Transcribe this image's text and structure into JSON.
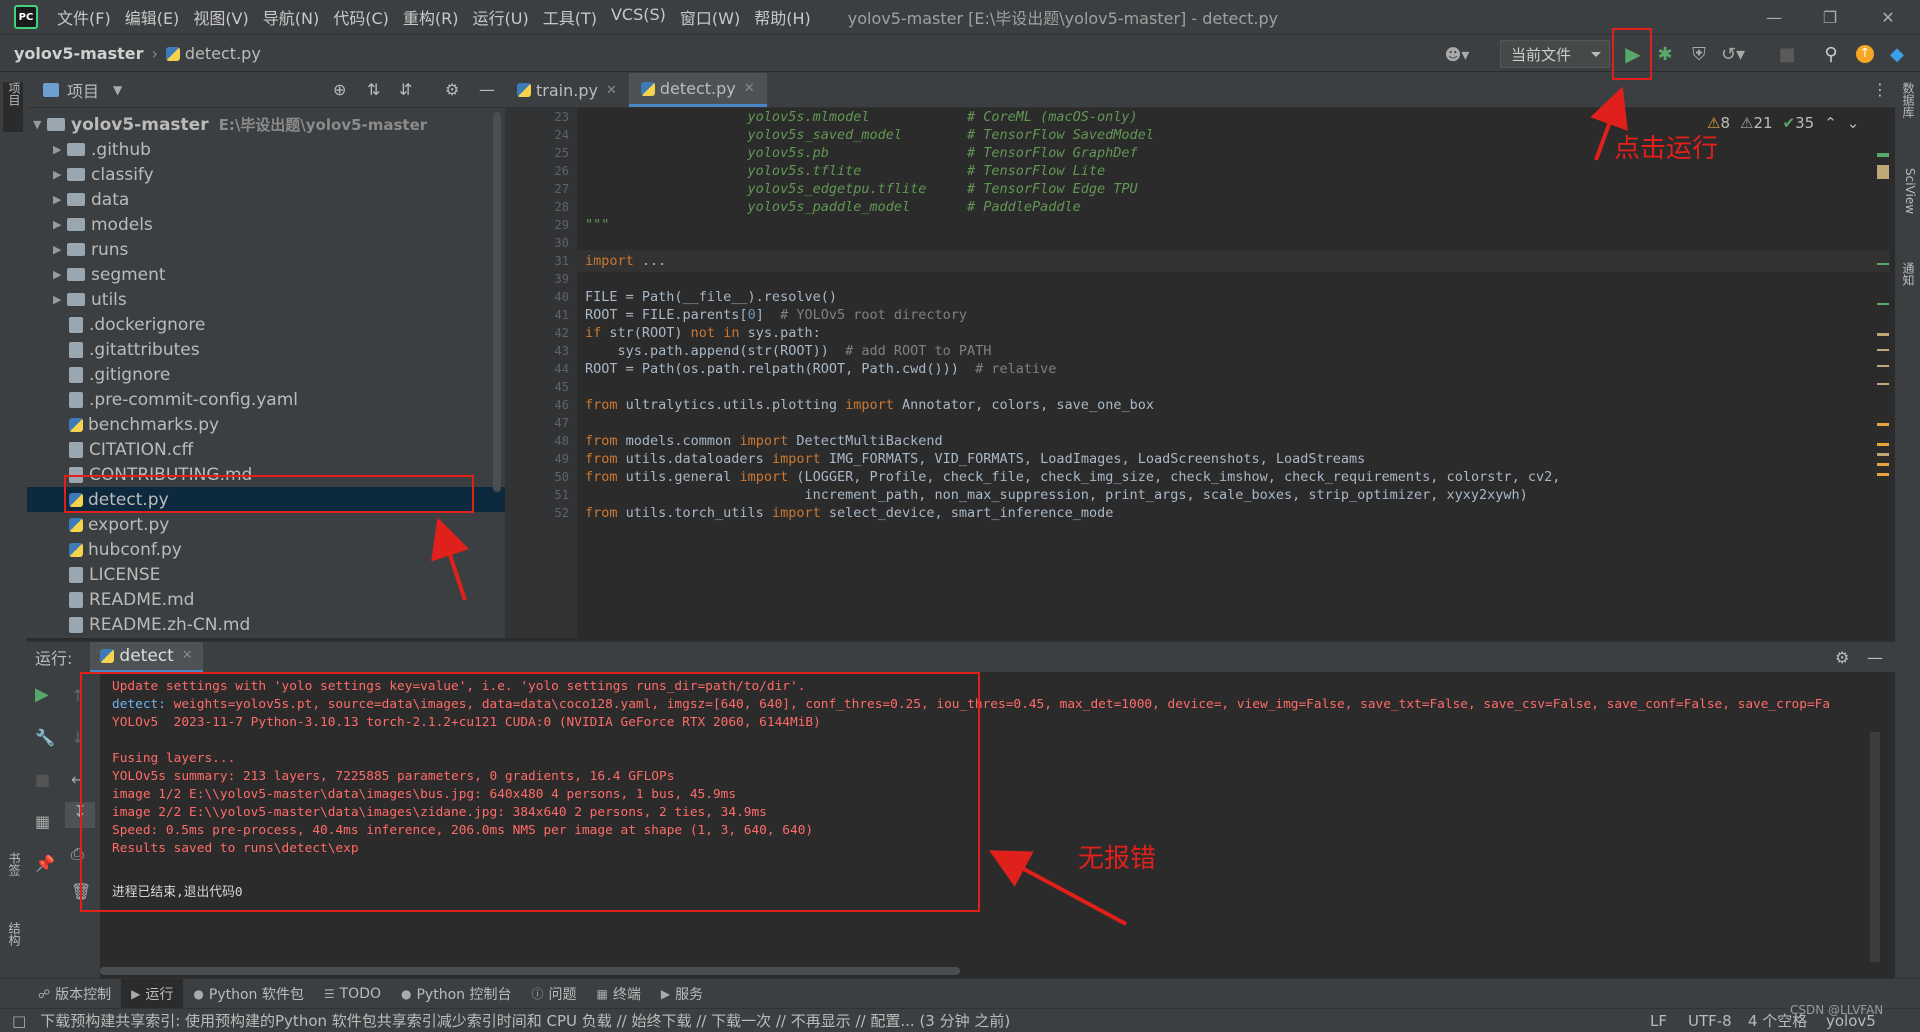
{
  "titlebar": {
    "logo": "PC",
    "menu": [
      "文件(F)",
      "编辑(E)",
      "视图(V)",
      "导航(N)",
      "代码(C)",
      "重构(R)",
      "运行(U)",
      "工具(T)",
      "VCS(S)",
      "窗口(W)",
      "帮助(H)"
    ],
    "title": "yolov5-master [E:\\毕设出题\\yolov5-master] - detect.py"
  },
  "navbar": {
    "project": "yolov5-master",
    "file": "detect.py",
    "run_config": "当前文件"
  },
  "left_stripe": {
    "project_tab": "项目",
    "bookmarks_tab": "书签",
    "structure_tab": "结构"
  },
  "right_stripe": {
    "db_tab": "数据库",
    "sciview_tab": "SciView",
    "notify_tab": "通知"
  },
  "project_panel": {
    "title": "项目",
    "root": "yolov5-master",
    "root_path": "E:\\毕设出题\\yolov5-master",
    "folders": [
      ".github",
      "classify",
      "data",
      "models",
      "runs",
      "segment",
      "utils"
    ],
    "files": [
      ".dockerignore",
      ".gitattributes",
      ".gitignore",
      ".pre-commit-config.yaml",
      "benchmarks.py",
      "CITATION.cff",
      "CONTRIBUTING.md",
      "detect.py",
      "export.py",
      "hubconf.py",
      "LICENSE",
      "README.md",
      "README.zh-CN.md"
    ],
    "selected": "detect.py"
  },
  "editor": {
    "tabs": [
      {
        "label": "train.py",
        "active": false
      },
      {
        "label": "detect.py",
        "active": true
      }
    ],
    "inspections": {
      "warnings": "8",
      "weak_warnings": "21",
      "ok": "35"
    },
    "lines": [
      {
        "n": "23",
        "code": "                    yolov5s.mlmodel            # CoreML (macOS-only)"
      },
      {
        "n": "24",
        "code": "                    yolov5s_saved_model        # TensorFlow SavedModel"
      },
      {
        "n": "25",
        "code": "                    yolov5s.pb                 # TensorFlow GraphDef"
      },
      {
        "n": "26",
        "code": "                    yolov5s.tflite             # TensorFlow Lite"
      },
      {
        "n": "27",
        "code": "                    yolov5s_edgetpu.tflite     # TensorFlow Edge TPU"
      },
      {
        "n": "28",
        "code": "                    yolov5s_paddle_model       # PaddlePaddle"
      },
      {
        "n": "29",
        "code": "\"\"\""
      },
      {
        "n": "30",
        "code": ""
      },
      {
        "n": "31",
        "code": "import ..."
      },
      {
        "n": "39",
        "code": ""
      },
      {
        "n": "40",
        "code": "FILE = Path(__file__).resolve()"
      },
      {
        "n": "41",
        "code": "ROOT = FILE.parents[0]  # YOLOv5 root directory"
      },
      {
        "n": "42",
        "code": "if str(ROOT) not in sys.path:"
      },
      {
        "n": "43",
        "code": "    sys.path.append(str(ROOT))  # add ROOT to PATH"
      },
      {
        "n": "44",
        "code": "ROOT = Path(os.path.relpath(ROOT, Path.cwd()))  # relative"
      },
      {
        "n": "45",
        "code": ""
      },
      {
        "n": "46",
        "code": "from ultralytics.utils.plotting import Annotator, colors, save_one_box"
      },
      {
        "n": "47",
        "code": ""
      },
      {
        "n": "48",
        "code": "from models.common import DetectMultiBackend"
      },
      {
        "n": "49",
        "code": "from utils.dataloaders import IMG_FORMATS, VID_FORMATS, LoadImages, LoadScreenshots, LoadStreams"
      },
      {
        "n": "50",
        "code": "from utils.general import (LOGGER, Profile, check_file, check_img_size, check_imshow, check_requirements, colorstr, cv2,"
      },
      {
        "n": "51",
        "code": "                           increment_path, non_max_suppression, print_args, scale_boxes, strip_optimizer, xyxy2xywh)"
      },
      {
        "n": "52",
        "code": "from utils.torch_utils import select_device, smart_inference_mode"
      }
    ]
  },
  "run_panel": {
    "label": "运行:",
    "tab": "detect",
    "console": [
      {
        "text": "Update settings with 'yolo settings key=value', i.e. 'yolo settings runs_dir=path/to/dir'.",
        "kind": "r"
      },
      {
        "text": "detect: weights=yolov5s.pt, source=data\\images, data=data\\coco128.yaml, imgsz=[640, 640], conf_thres=0.25, iou_thres=0.45, max_det=1000, device=, view_img=False, save_txt=False, save_csv=False, save_conf=False, save_crop=Fa",
        "kind": "r"
      },
      {
        "text": "YOLOv5  2023-11-7 Python-3.10.13 torch-2.1.2+cu121 CUDA:0 (NVIDIA GeForce RTX 2060, 6144MiB)",
        "kind": "r"
      },
      {
        "text": "",
        "kind": "r"
      },
      {
        "text": "Fusing layers...",
        "kind": "r"
      },
      {
        "text": "YOLOv5s summary: 213 layers, 7225885 parameters, 0 gradients, 16.4 GFLOPs",
        "kind": "r"
      },
      {
        "text": "image 1/2 E:\\\\yolov5-master\\data\\images\\bus.jpg: 640x480 4 persons, 1 bus, 45.9ms",
        "kind": "r"
      },
      {
        "text": "image 2/2 E:\\\\yolov5-master\\data\\images\\zidane.jpg: 384x640 2 persons, 2 ties, 34.9ms",
        "kind": "r"
      },
      {
        "text": "Speed: 0.5ms pre-process, 40.4ms inference, 206.0ms NMS per image at shape (1, 3, 640, 640)",
        "kind": "r"
      },
      {
        "text": "Results saved to runs\\detect\\exp",
        "kind": "r"
      },
      {
        "text": "",
        "kind": "g"
      },
      {
        "text": "进程已结束,退出代码0",
        "kind": "w"
      }
    ]
  },
  "tool_windows": [
    "版本控制",
    "运行",
    "Python 软件包",
    "TODO",
    "Python 控制台",
    "问题",
    "终端",
    "服务"
  ],
  "statusbar": {
    "message": "下载预构建共享索引: 使用预构建的Python 软件包共享索引减少索引时间和 CPU 负载 // 始终下载 // 下载一次 // 不再显示 // 配置... (3 分钟 之前)",
    "line_sep": "LF",
    "encoding": "UTF-8",
    "indent": "4 个空格",
    "interpreter": "yolov5",
    "watermark": "CSDN @LLVFAN"
  },
  "annotations": {
    "run_hint": "点击运行",
    "no_error": "无报错"
  }
}
